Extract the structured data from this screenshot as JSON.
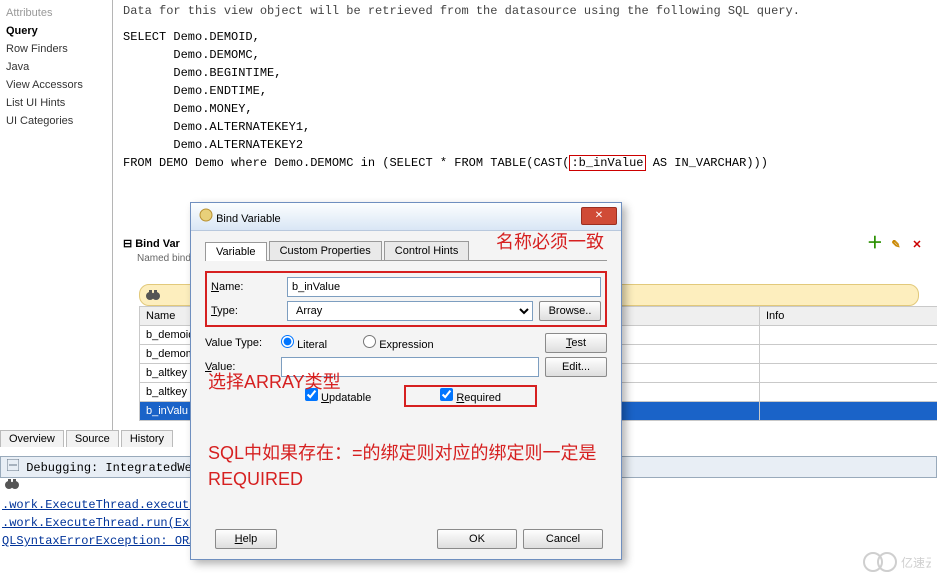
{
  "sidebar": {
    "items": [
      {
        "label": "Attributes",
        "cut": true
      },
      {
        "label": "Query",
        "sel": true
      },
      {
        "label": "Row Finders"
      },
      {
        "label": "Java"
      },
      {
        "label": "View Accessors"
      },
      {
        "label": "List UI Hints"
      },
      {
        "label": "UI Categories"
      }
    ]
  },
  "hint": "Data for this view object will be retrieved from the datasource using the following SQL query.",
  "sql": {
    "pre": "SELECT Demo.DEMOID,\n       Demo.DEMOMC,\n       Demo.BEGINTIME,\n       Demo.ENDTIME,\n       Demo.MONEY,\n       Demo.ALTERNATEKEY1,\n       Demo.ALTERNATEKEY2\nFROM DEMO Demo where Demo.DEMOMC in (SELECT * FROM TABLE(CAST(",
    "var": ":b_inValue",
    "post": " AS IN_VARCHAR)))"
  },
  "expander": {
    "title": "Bind Var",
    "sub": "Named bind"
  },
  "grid": {
    "headers": [
      "Name",
      "",
      "",
      "Info"
    ],
    "rows": [
      {
        "name": "b_demoid"
      },
      {
        "name": "b_demomc"
      },
      {
        "name": "b_altkey"
      },
      {
        "name": "b_altkey"
      },
      {
        "name": "b_inValu",
        "hl": true
      }
    ]
  },
  "bottom_tabs": [
    "Overview",
    "Source",
    "History"
  ],
  "debug": {
    "title": "Debugging: IntegratedWebLogi",
    "lines": [
      ".work.ExecuteThread.execute",
      ".work.ExecuteThread.run(Exe"
    ],
    "errline_pre": "QLSyntaxErrorException: ",
    "errline_err": "ORA"
  },
  "dialog": {
    "title": "Bind Variable",
    "tabs": [
      "Variable",
      "Custom Properties",
      "Control Hints"
    ],
    "name_label": "Name:",
    "name_value": "b_inValue",
    "type_label": "Type:",
    "type_value": "Array",
    "browse": "Browse..",
    "vtype_label": "Value Type:",
    "vtype_literal": "Literal",
    "vtype_expr": "Expression",
    "test": "Test",
    "value_label": "Value:",
    "value_value": "",
    "edit": "Edit...",
    "updatable": "Updatable",
    "required": "Required",
    "help": "Help",
    "ok": "OK",
    "cancel": "Cancel"
  },
  "annotations": {
    "a1": "名称必须一致",
    "a2": "选择ARRAY类型",
    "a3": "SQL中如果存在：=的绑定则对应的绑定则一定是REQUIRED"
  },
  "watermark": "亿速云"
}
